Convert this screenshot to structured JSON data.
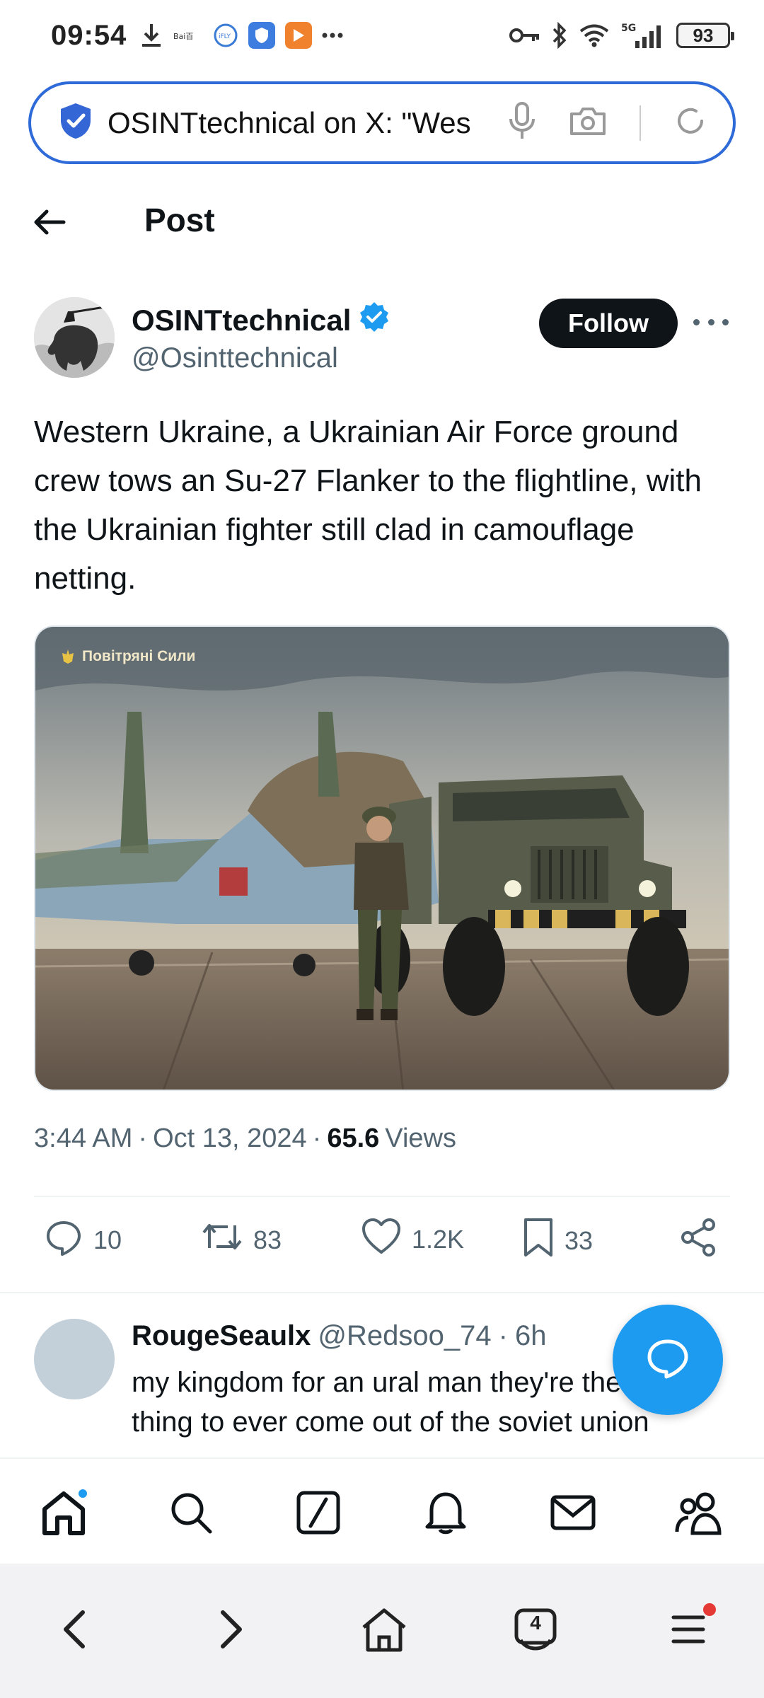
{
  "status_bar": {
    "time": "09:54",
    "battery": "93",
    "network": "5G"
  },
  "url_bar": {
    "text": "OSINTtechnical on X: \"Wes"
  },
  "header": {
    "title": "Post"
  },
  "author": {
    "name": "OSINTtechnical",
    "handle": "@Osinttechnical",
    "follow_label": "Follow"
  },
  "tweet": {
    "text": "Western Ukraine, a Ukrainian Air Force ground crew tows an Su-27 Flanker to the flightline, with the Ukrainian fighter still clad in camouflage netting.",
    "media_caption": "Повітряні Сили",
    "time": "3:44 AM",
    "date": "Oct 13, 2024",
    "views_count": "65.6",
    "views_label": "Views"
  },
  "actions": {
    "replies": "10",
    "reposts": "83",
    "likes": "1.2K",
    "bookmarks": "33"
  },
  "reply": {
    "name": "RougeSeaulx",
    "handle": "@Redsoo_74",
    "age": "6h",
    "text": "my kingdom for an ural man they're the best thing to ever come out of the soviet union"
  },
  "browser_nav": {
    "tabs_count": "4"
  },
  "colors": {
    "accent": "#1d9bf0",
    "url_border": "#2f6bd8",
    "text": "#0f1419",
    "secondary": "#536471"
  }
}
